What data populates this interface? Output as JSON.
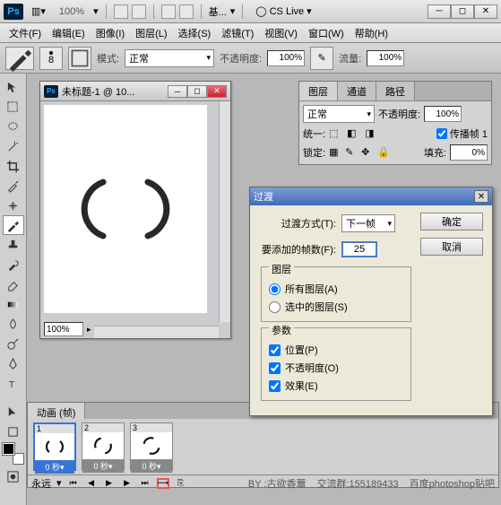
{
  "titlebar": {
    "zoom": "100%",
    "essentials": "基...",
    "cslive": "CS Live"
  },
  "menus": [
    "文件(F)",
    "编辑(E)",
    "图像(I)",
    "图层(L)",
    "选择(S)",
    "滤镜(T)",
    "视图(V)",
    "窗口(W)",
    "帮助(H)"
  ],
  "options": {
    "brush_size": "8",
    "mode_label": "模式:",
    "mode_value": "正常",
    "opacity_label": "不透明度:",
    "opacity_value": "100%",
    "flow_label": "流量:",
    "flow_value": "100%"
  },
  "document": {
    "title": "未标题-1 @ 10...",
    "zoom": "100%"
  },
  "layers_panel": {
    "tabs": [
      "图层",
      "通道",
      "路径"
    ],
    "blend": "正常",
    "opacity_label": "不透明度:",
    "opacity_value": "100%",
    "unify_label": "统一:",
    "propagate_label": "传播帧 1",
    "lock_label": "锁定:",
    "fill_label": "填充:",
    "fill_value": "0%"
  },
  "dialog": {
    "title": "过渡",
    "method_label": "过渡方式(T):",
    "method_value": "下一帧",
    "frames_label": "要添加的帧数(F):",
    "frames_value": "25",
    "layers_group": "图层",
    "layers_all": "所有图层(A)",
    "layers_sel": "选中的图层(S)",
    "params_group": "参数",
    "param_pos": "位置(P)",
    "param_opa": "不透明度(O)",
    "param_eff": "效果(E)",
    "ok": "确定",
    "cancel": "取消"
  },
  "animation": {
    "tab": "动画 (帧)",
    "frames": [
      {
        "n": "1",
        "time": "0 秒▾",
        "sel": true
      },
      {
        "n": "2",
        "time": "0 秒▾",
        "sel": false
      },
      {
        "n": "3",
        "time": "0 秒▾",
        "sel": false
      }
    ],
    "loop": "永远",
    "credit_by": "BY :古欲香蕈",
    "credit_qun": "交流群:155189433",
    "credit_tieba": "百度photoshop贴吧"
  }
}
